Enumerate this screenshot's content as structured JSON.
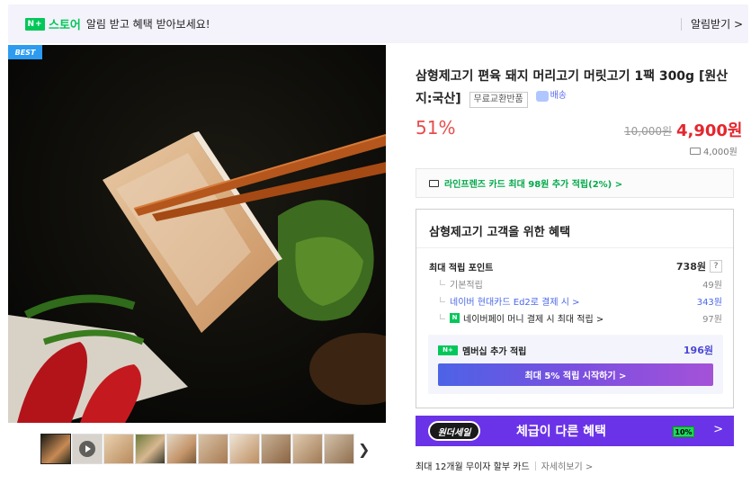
{
  "banner": {
    "logo_mark": "N+",
    "logo_text": "스토어",
    "message": "알림 받고 혜택 받아보세요!",
    "action": "알림받기 >"
  },
  "gallery": {
    "badge": "BEST",
    "thumbnail_count": 10,
    "active_index": 0,
    "next_icon": "chevron-right-icon"
  },
  "product": {
    "title": "삼형제고기 편육 돼지 머리고기 머릿고기 1팩 300g [원산지:국산]",
    "return_badge": "무료교환반품",
    "delivery_badge": "배송",
    "discount_rate": "51%",
    "original_price": "10,000원",
    "sale_price": "4,900원",
    "shipping_fee": "4,000원"
  },
  "card_promo": {
    "text": "라인프렌즈 카드 최대 98원 추가 적립(2%) >"
  },
  "benefits": {
    "title": "삼형제고기 고객을 위한 혜택",
    "max_points_label": "최대 적립 포인트",
    "max_points_value": "738원",
    "help": "?",
    "items": [
      {
        "label": "기본적립",
        "value": "49원"
      },
      {
        "label": "네이버 현대카드 Ed2로 결제 시 >",
        "value": "343원"
      },
      {
        "label": "네이버페이 머니 결제 시 최대 적립 >",
        "value": "97원"
      }
    ],
    "membership": {
      "badge": "N+",
      "label": "멤버십 추가 적립",
      "value": "196원",
      "button": "최대 5% 적립 시작하기 >"
    }
  },
  "promo_banner": {
    "logo": "원더세일",
    "text": "체급이 다른 혜택",
    "badge": "10%",
    "arrow": ">"
  },
  "installment": {
    "text": "최대 12개월 무이자 할부 카드",
    "link": "자세히보기 >"
  },
  "colors": {
    "naver_green": "#03c75a",
    "price_red": "#e4262d",
    "discount_red": "#e64d4d",
    "promo_purple": "#6b33e8",
    "link_blue": "#4a67e8"
  }
}
